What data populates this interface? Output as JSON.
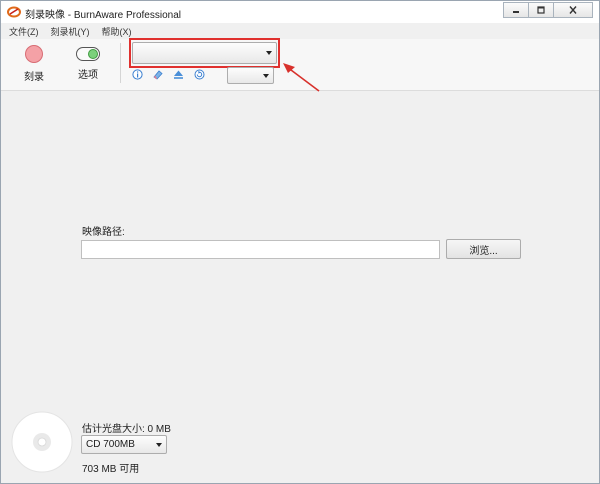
{
  "window": {
    "title": "刻录映像 - BurnAware Professional"
  },
  "menu": [
    "文件(Z)",
    "刻录机(Y)",
    "帮助(X)"
  ],
  "toolbar": {
    "burn_label": "刻录",
    "options_label": "选项",
    "drive_select_value": "",
    "speed_select_value": ""
  },
  "main": {
    "image_path_label": "映像路径:",
    "image_path_value": "",
    "browse_label": "浏览..."
  },
  "footer": {
    "estimated_size": "估计光盘大小: 0 MB",
    "disc_type": "CD 700MB",
    "available": "703 MB 可用"
  },
  "colors": {
    "highlight": "#e0302e",
    "burn_icon": "#f4a1a6",
    "toggle_knob": "#7bd07b",
    "tool_icon_blue": "#3a7fd0"
  }
}
